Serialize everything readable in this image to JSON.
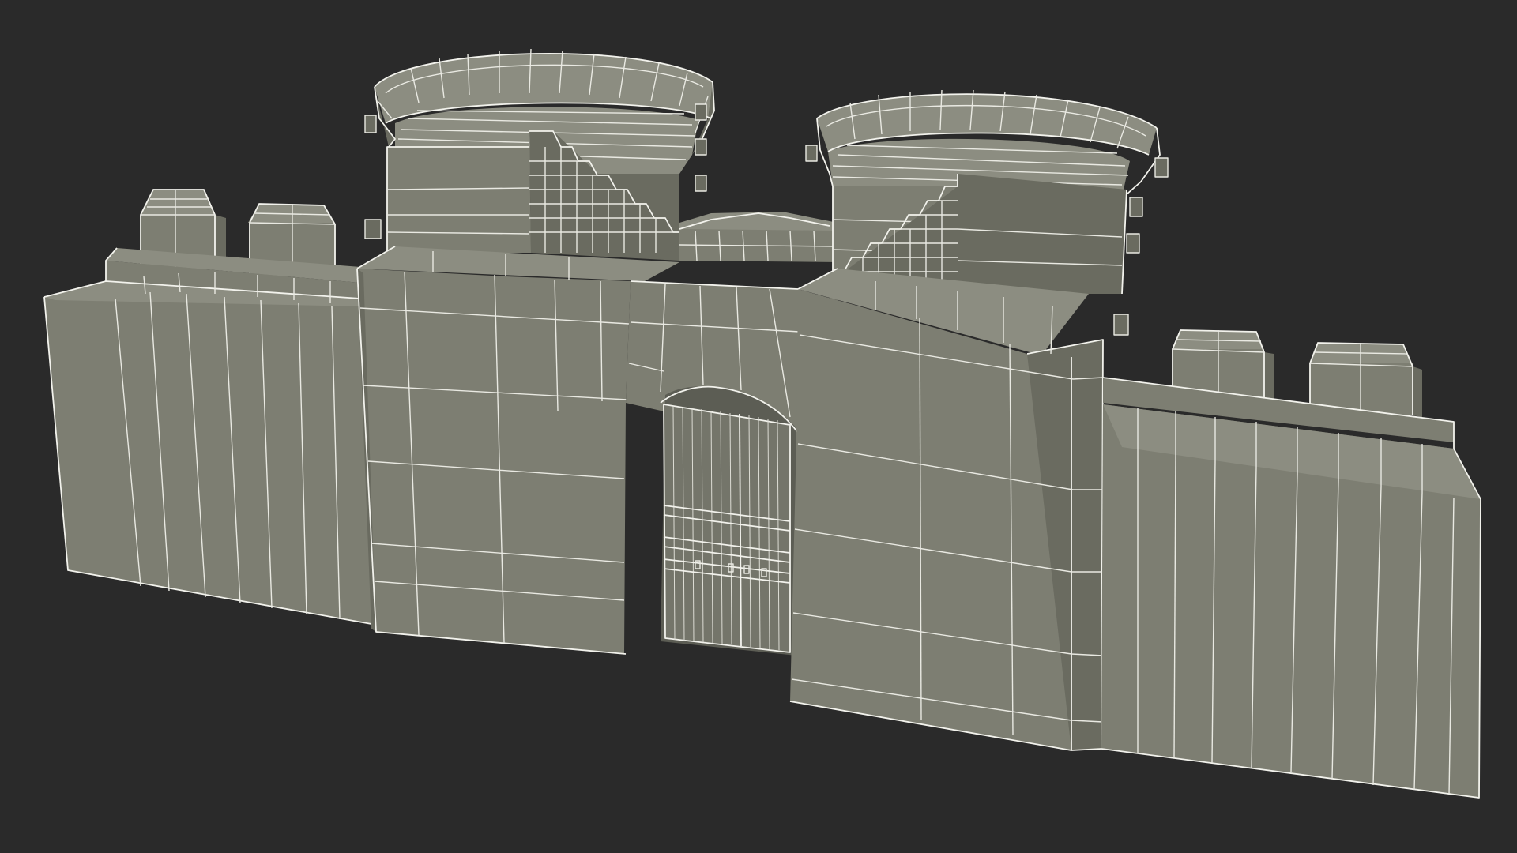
{
  "viewport": {
    "background": "#2a2a2a",
    "model_fill": "#7d7e72",
    "wire_color": "#e9e9e2"
  }
}
